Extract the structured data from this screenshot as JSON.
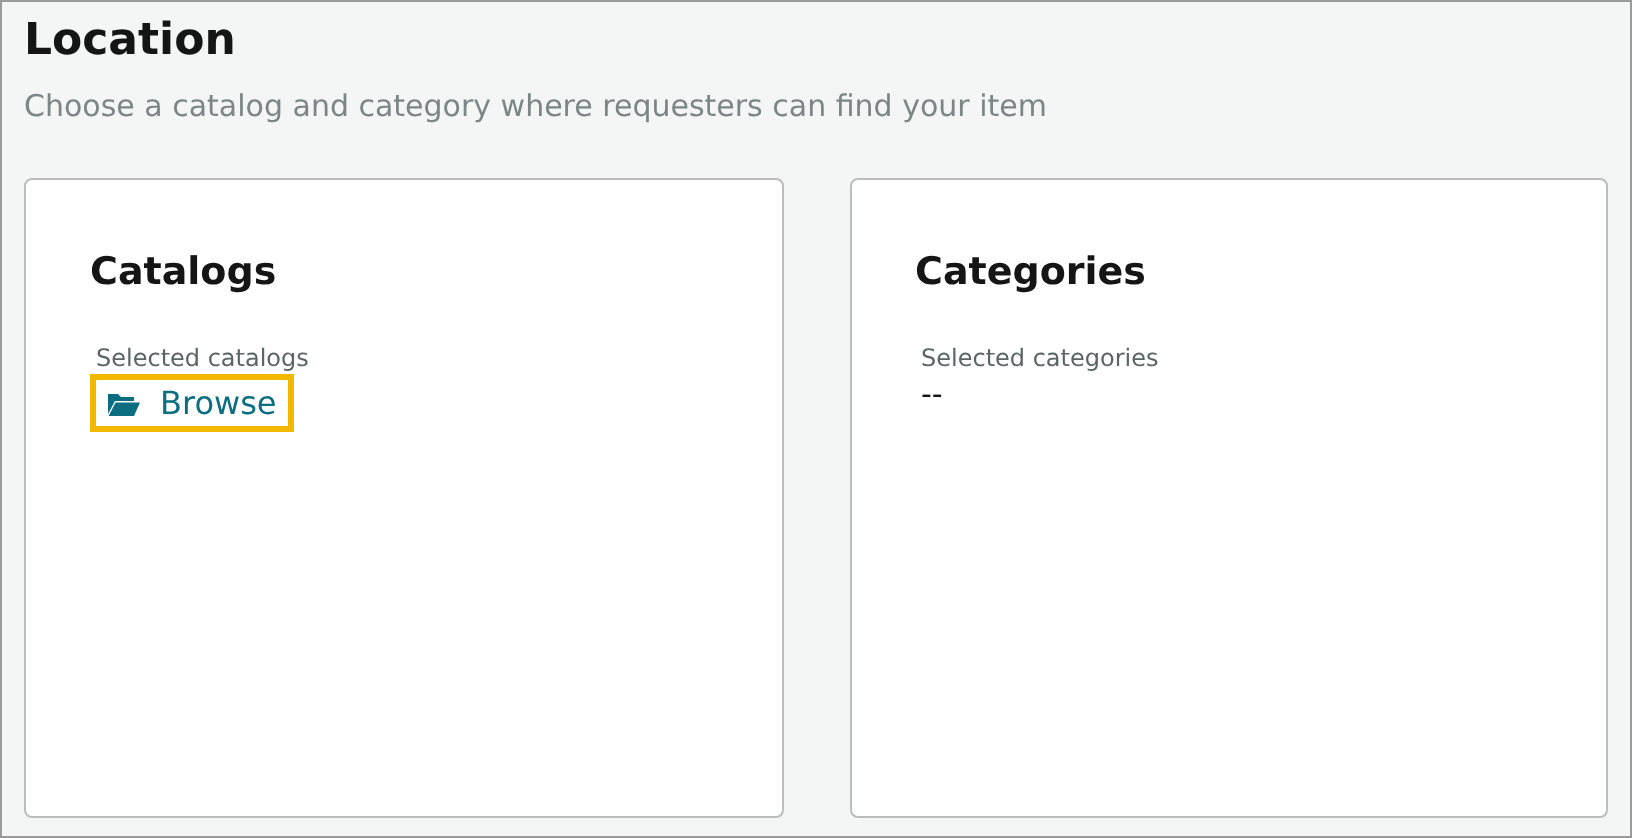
{
  "header": {
    "title": "Location",
    "subtitle": "Choose a catalog and category where requesters can find your item"
  },
  "cards": [
    {
      "title": "Catalogs",
      "label": "Selected catalogs",
      "kind": "link",
      "text": "Browse",
      "highlighted": true
    },
    {
      "title": "Categories",
      "label": "Selected categories",
      "kind": "value",
      "text": "--"
    }
  ]
}
